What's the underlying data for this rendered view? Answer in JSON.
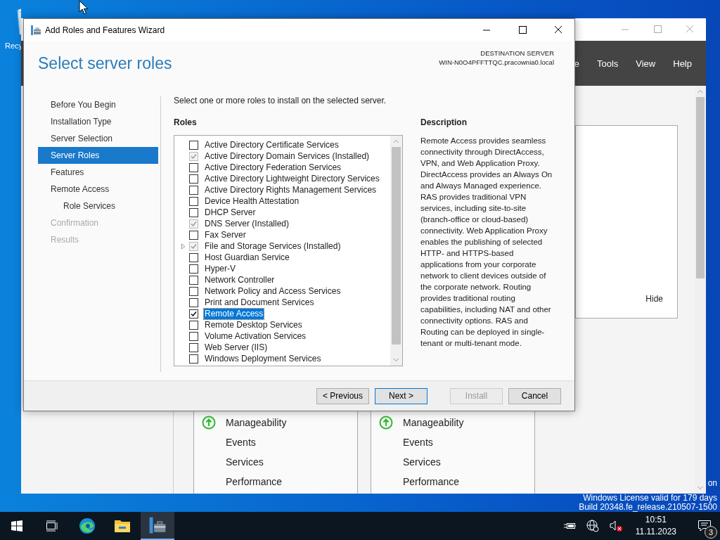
{
  "desktop": {
    "icon_label": "Recy",
    "watermark": [
      "on",
      "Windows License valid for 179 days",
      "Build 20348.fe_release.210507-1500"
    ]
  },
  "server_manager": {
    "menu": [
      "e",
      "Tools",
      "View",
      "Help"
    ],
    "panel": {
      "hide_label": "Hide"
    },
    "tiles": [
      {
        "items": [
          {
            "label": "Manageability",
            "kind": "status"
          },
          {
            "label": "Events",
            "kind": "link"
          },
          {
            "label": "Services",
            "kind": "link"
          },
          {
            "label": "Performance",
            "kind": "link"
          }
        ]
      },
      {
        "items": [
          {
            "label": "Manageability",
            "kind": "status"
          },
          {
            "label": "Events",
            "kind": "link"
          },
          {
            "label": "Services",
            "kind": "link"
          },
          {
            "label": "Performance",
            "kind": "link"
          }
        ]
      }
    ]
  },
  "wizard": {
    "title": "Add Roles and Features Wizard",
    "heading": "Select server roles",
    "destination": {
      "label": "DESTINATION SERVER",
      "value": "WIN-N0O4PFFTTQC.pracownia0.local"
    },
    "nav": [
      {
        "label": "Before You Begin",
        "selected": false,
        "disabled": false
      },
      {
        "label": "Installation Type",
        "selected": false,
        "disabled": false
      },
      {
        "label": "Server Selection",
        "selected": false,
        "disabled": false
      },
      {
        "label": "Server Roles",
        "selected": true,
        "disabled": false
      },
      {
        "label": "Features",
        "selected": false,
        "disabled": false
      },
      {
        "label": "Remote Access",
        "selected": false,
        "disabled": false,
        "children": [
          {
            "label": "Role Services",
            "selected": false,
            "disabled": false
          }
        ]
      },
      {
        "label": "Confirmation",
        "selected": false,
        "disabled": true
      },
      {
        "label": "Results",
        "selected": false,
        "disabled": true
      }
    ],
    "instruction": "Select one or more roles to install on the selected server.",
    "roles": {
      "heading": "Roles",
      "items": [
        {
          "label": "Active Directory Certificate Services",
          "checked": false,
          "disabled": false,
          "expandable": false,
          "selected": false
        },
        {
          "label": "Active Directory Domain Services (Installed)",
          "checked": true,
          "disabled": true,
          "expandable": false,
          "selected": false
        },
        {
          "label": "Active Directory Federation Services",
          "checked": false,
          "disabled": false,
          "expandable": false,
          "selected": false
        },
        {
          "label": "Active Directory Lightweight Directory Services",
          "checked": false,
          "disabled": false,
          "expandable": false,
          "selected": false
        },
        {
          "label": "Active Directory Rights Management Services",
          "checked": false,
          "disabled": false,
          "expandable": false,
          "selected": false
        },
        {
          "label": "Device Health Attestation",
          "checked": false,
          "disabled": false,
          "expandable": false,
          "selected": false
        },
        {
          "label": "DHCP Server",
          "checked": false,
          "disabled": false,
          "expandable": false,
          "selected": false
        },
        {
          "label": "DNS Server (Installed)",
          "checked": true,
          "disabled": true,
          "expandable": false,
          "selected": false
        },
        {
          "label": "Fax Server",
          "checked": false,
          "disabled": false,
          "expandable": false,
          "selected": false
        },
        {
          "label": "File and Storage Services (Installed)",
          "checked": true,
          "disabled": true,
          "expandable": true,
          "selected": false
        },
        {
          "label": "Host Guardian Service",
          "checked": false,
          "disabled": false,
          "expandable": false,
          "selected": false
        },
        {
          "label": "Hyper-V",
          "checked": false,
          "disabled": false,
          "expandable": false,
          "selected": false
        },
        {
          "label": "Network Controller",
          "checked": false,
          "disabled": false,
          "expandable": false,
          "selected": false
        },
        {
          "label": "Network Policy and Access Services",
          "checked": false,
          "disabled": false,
          "expandable": false,
          "selected": false
        },
        {
          "label": "Print and Document Services",
          "checked": false,
          "disabled": false,
          "expandable": false,
          "selected": false
        },
        {
          "label": "Remote Access",
          "checked": true,
          "disabled": false,
          "expandable": false,
          "selected": true
        },
        {
          "label": "Remote Desktop Services",
          "checked": false,
          "disabled": false,
          "expandable": false,
          "selected": false
        },
        {
          "label": "Volume Activation Services",
          "checked": false,
          "disabled": false,
          "expandable": false,
          "selected": false
        },
        {
          "label": "Web Server (IIS)",
          "checked": false,
          "disabled": false,
          "expandable": false,
          "selected": false
        },
        {
          "label": "Windows Deployment Services",
          "checked": false,
          "disabled": false,
          "expandable": false,
          "selected": false
        }
      ]
    },
    "description": {
      "heading": "Description",
      "text": "Remote Access provides seamless connectivity through DirectAccess, VPN, and Web Application Proxy. DirectAccess provides an Always On and Always Managed experience. RAS provides traditional VPN services, including site-to-site (branch-office or cloud-based) connectivity. Web Application Proxy enables the publishing of selected HTTP- and HTTPS-based applications from your corporate network to client devices outside of the corporate network. Routing provides traditional routing capabilities, including NAT and other connectivity options. RAS and Routing can be deployed in single-tenant or multi-tenant mode."
    },
    "buttons": [
      {
        "label": "< Previous",
        "default": false,
        "disabled": false
      },
      {
        "label": "Next >",
        "default": true,
        "disabled": false
      },
      {
        "label": "Install",
        "default": false,
        "disabled": true
      },
      {
        "label": "Cancel",
        "default": false,
        "disabled": false
      }
    ]
  },
  "taskbar": {
    "apps": [
      {
        "kind": "start",
        "selected": false
      },
      {
        "kind": "taskview",
        "selected": false
      },
      {
        "kind": "browser",
        "selected": false
      },
      {
        "kind": "folder",
        "selected": false
      },
      {
        "kind": "servermanager",
        "selected": true
      }
    ],
    "clock": {
      "time": "10:51",
      "date": "11.11.2023"
    },
    "notifications": "3"
  }
}
